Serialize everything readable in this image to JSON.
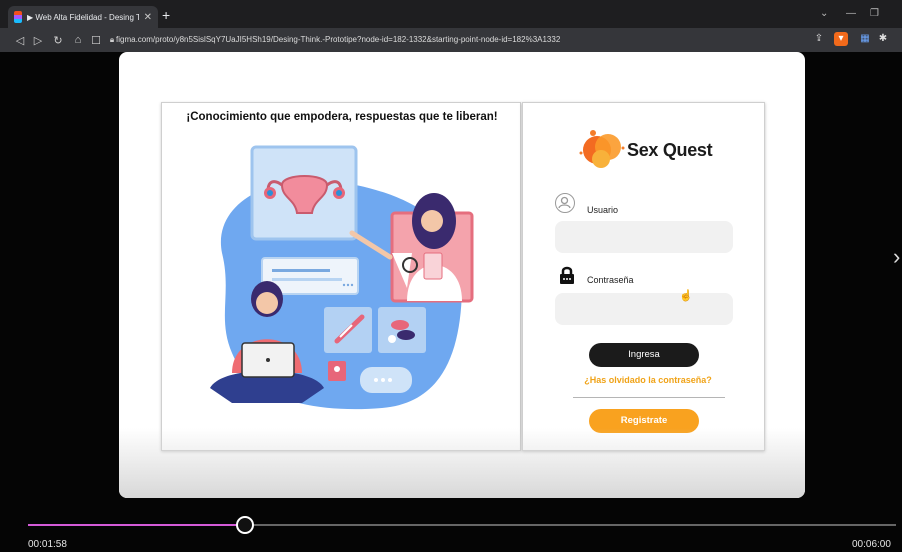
{
  "browser": {
    "tab_title": "▶ Web Alta Fidelidad - Desing Th",
    "url": "figma.com/proto/y8n5SislSqY7UaJI5HSh19/Desing-Think.-Prototipe?node-id=182-1332&starting-point-node-id=182%3A1332"
  },
  "prototype": {
    "headline": "¡Conocimiento que empodera, respuestas que te liberan!",
    "brand_name": "Sex Quest",
    "username_label": "Usuario",
    "username_value": "",
    "password_label": "Contraseña",
    "password_value": "",
    "login_button": "Ingresa",
    "forgot_link": "¿Has olvidado la contraseña?",
    "register_button": "Registrate"
  },
  "player": {
    "current_time": "00:01:58",
    "total_time": "00:06:00",
    "progress_percent": 25
  },
  "colors": {
    "accent_orange": "#f9a21f",
    "dark_button": "#1b1b1b",
    "illustration_blue": "#6fa8f0",
    "progress_purple": "#d45bd8"
  },
  "icons": {
    "user": "user-circle-icon",
    "password": "lock-icon",
    "next": "chevron-right-icon"
  }
}
